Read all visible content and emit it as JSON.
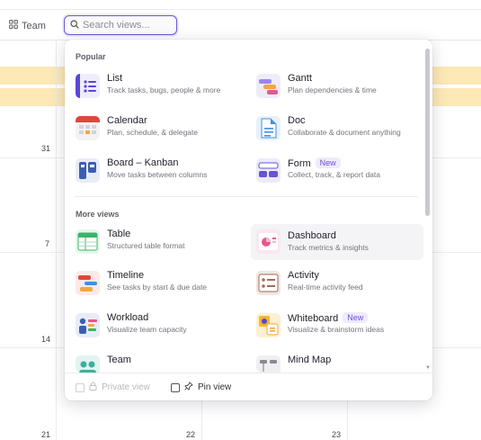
{
  "toolbar": {
    "team_label": "Team",
    "search_placeholder": "Search views..."
  },
  "calendar": {
    "day_numbers": [
      "31",
      "7",
      "14",
      "21",
      "22",
      "23"
    ]
  },
  "dropdown": {
    "popular_title": "Popular",
    "more_title": "More views",
    "popular": [
      {
        "title": "List",
        "desc": "Track tasks, bugs, people & more",
        "icon": "list-icon"
      },
      {
        "title": "Gantt",
        "desc": "Plan dependencies & time",
        "icon": "gantt-icon"
      },
      {
        "title": "Calendar",
        "desc": "Plan, schedule, & delegate",
        "icon": "calendar-icon"
      },
      {
        "title": "Doc",
        "desc": "Collaborate & document anything",
        "icon": "doc-icon"
      },
      {
        "title": "Board – Kanban",
        "desc": "Move tasks between columns",
        "icon": "board-icon"
      },
      {
        "title": "Form",
        "desc": "Collect, track, & report data",
        "icon": "form-icon",
        "badge": "New"
      }
    ],
    "more": [
      {
        "title": "Table",
        "desc": "Structured table format",
        "icon": "table-icon"
      },
      {
        "title": "Dashboard",
        "desc": "Track metrics & insights",
        "icon": "dashboard-icon"
      },
      {
        "title": "Timeline",
        "desc": "See tasks by start & due date",
        "icon": "timeline-icon"
      },
      {
        "title": "Activity",
        "desc": "Real-time activity feed",
        "icon": "activity-icon"
      },
      {
        "title": "Workload",
        "desc": "Visualize team capacity",
        "icon": "workload-icon"
      },
      {
        "title": "Whiteboard",
        "desc": "Visualize & brainstorm ideas",
        "icon": "whiteboard-icon",
        "badge": "New"
      },
      {
        "title": "Team",
        "desc": "",
        "icon": "team-icon"
      },
      {
        "title": "Mind Map",
        "desc": "",
        "icon": "mind-map-icon"
      }
    ],
    "footer": {
      "private_label": "Private view",
      "pin_label": "Pin view"
    }
  },
  "colors": {
    "accent": "#6b57d6",
    "band": "#fde9b6"
  }
}
